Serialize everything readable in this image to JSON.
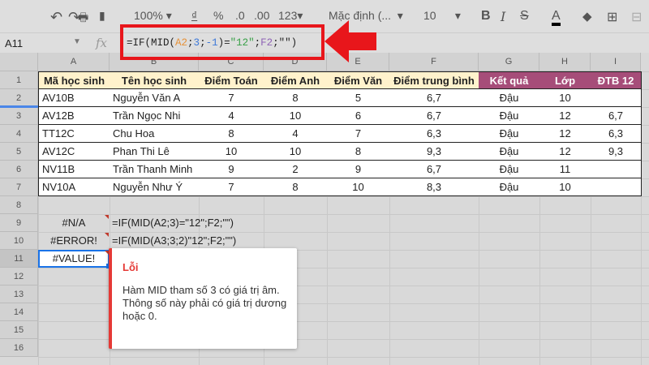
{
  "toolbar": {
    "zoom": "100%",
    "currency": "₫",
    "percent": "%",
    "dec_less": ".0",
    "dec_more": ".00",
    "format": "123",
    "font": "Mặc định (...",
    "size": "10"
  },
  "formula_bar": {
    "cell": "A11",
    "fx": "fx",
    "formula_parts": [
      "=IF(MID(",
      "A2",
      ";",
      "3",
      ";",
      "-1",
      ")=",
      "\"12\"",
      ";",
      "F2",
      ";\"\")"
    ]
  },
  "columns": [
    "A",
    "B",
    "C",
    "D",
    "E",
    "F",
    "G",
    "H",
    "I"
  ],
  "rows": [
    "1",
    "2",
    "3",
    "4",
    "5",
    "6",
    "7",
    "8",
    "9",
    "10",
    "11",
    "12",
    "13",
    "14",
    "15",
    "16"
  ],
  "headers": [
    "Mã học sinh",
    "Tên học sinh",
    "Điểm Toán",
    "Điểm Anh",
    "Điểm Văn",
    "Điểm trung bình",
    "Kết quả",
    "Lớp",
    "ĐTB 12"
  ],
  "data": [
    [
      "AV10B",
      "Nguyễn Văn A",
      "7",
      "8",
      "5",
      "6,7",
      "Đậu",
      "10",
      ""
    ],
    [
      "AV12B",
      "Trần Ngọc Nhi",
      "4",
      "10",
      "6",
      "6,7",
      "Đậu",
      "12",
      "6,7"
    ],
    [
      "TT12C",
      "Chu Hoa",
      "8",
      "4",
      "7",
      "6,3",
      "Đậu",
      "12",
      "6,3"
    ],
    [
      "AV12C",
      "Phan Thi Lê",
      "10",
      "10",
      "8",
      "9,3",
      "Đậu",
      "12",
      "9,3"
    ],
    [
      "NV11B",
      "Trần Thanh Minh",
      "9",
      "2",
      "9",
      "6,7",
      "Đậu",
      "11",
      ""
    ],
    [
      "NV10A",
      "Nguyễn Như Ý",
      "7",
      "8",
      "10",
      "8,3",
      "Đậu",
      "10",
      ""
    ]
  ],
  "errors": [
    {
      "value": "#N/A",
      "formula": "=IF(MID(A2;3)=\"12\";F2;\"\")"
    },
    {
      "value": "#ERROR!",
      "formula": "=IF(MID(A3;3;2)\"12\";F2;\"\")"
    },
    {
      "value": "#VALUE!",
      "formula": ""
    }
  ],
  "popup": {
    "title": "Lỗi",
    "message": "Hàm MID tham số 3 có giá trị âm. Thông số này phải có giá trị dương hoặc 0."
  },
  "colors": {
    "header_bg": "#fff2cc",
    "header_purple": "#a64d79",
    "error": "#e53935",
    "highlight": "#e8161b"
  }
}
